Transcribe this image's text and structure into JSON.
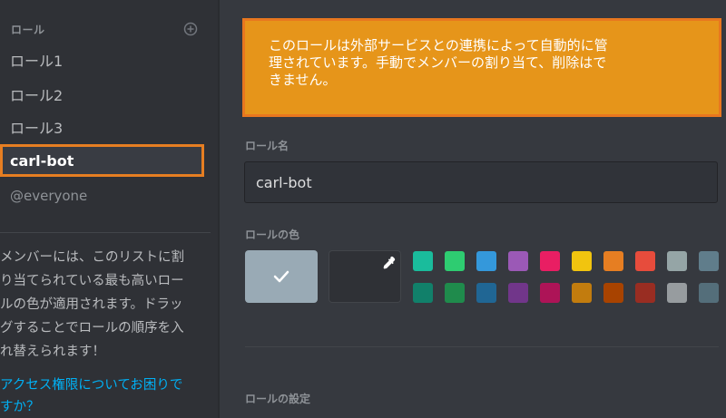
{
  "sidebar": {
    "title": "ロール",
    "roles": [
      {
        "label": "ロール1"
      },
      {
        "label": "ロール2"
      },
      {
        "label": "ロール3"
      },
      {
        "label": "carl-bot"
      },
      {
        "label": "@everyone"
      }
    ],
    "selected_role": "carl-bot",
    "help_text": "メンバーには、このリストに割\nり当てられている最も高いロー\nルの色が適用されます。ドラッ\nグすることでロールの順序を入\nれ替えられます！",
    "help_link": "アクセス権限についてお困りで\nすか？"
  },
  "notice": {
    "text": "このロールは外部サービスとの連携によって自動的に管\n理されています。手動でメンバーの割り当て、削除はで\nきません。"
  },
  "role_name": {
    "label": "ロール名",
    "value": "carl-bot"
  },
  "role_color": {
    "label": "ロールの色",
    "default_color": "#99aab5",
    "palette_row1": [
      "#1abc9c",
      "#2ecc71",
      "#3498db",
      "#9b59b6",
      "#e91e63",
      "#f1c40f",
      "#e67e22",
      "#e74c3c",
      "#95a5a6",
      "#607d8b"
    ],
    "palette_row2": [
      "#11806a",
      "#1f8b4c",
      "#206694",
      "#71368a",
      "#ad1457",
      "#c27c0e",
      "#a84300",
      "#992d22",
      "#979c9f",
      "#546e7a"
    ]
  },
  "role_settings": {
    "label": "ロールの設定"
  },
  "colors": {
    "accent_highlight": "#e67e22",
    "notice_bg": "#e6951a",
    "link": "#00b0f4"
  }
}
